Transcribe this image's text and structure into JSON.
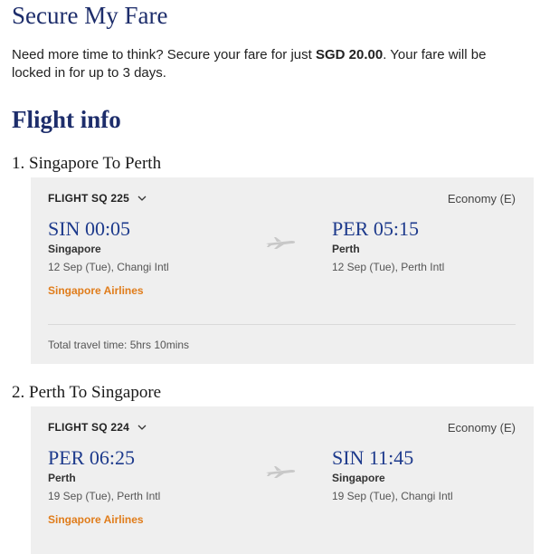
{
  "header": {
    "title": "Secure My Fare",
    "intro_before": "Need more time to think? Secure your fare for just ",
    "intro_price": "SGD 20.00",
    "intro_after": ". Your fare will be locked in for up to 3 days."
  },
  "flight_info": {
    "title": "Flight info",
    "routes": [
      {
        "heading": "1. Singapore To Perth",
        "flight_label": "FLIGHT SQ 225",
        "cabin": "Economy (E)",
        "departure": {
          "code_time": "SIN 00:05",
          "city": "Singapore",
          "detail": "12 Sep (Tue), Changi Intl"
        },
        "arrival": {
          "code_time": "PER 05:15",
          "city": "Perth",
          "detail": "12 Sep (Tue), Perth Intl"
        },
        "airline": "Singapore Airlines",
        "total_time": "Total travel time: 5hrs 10mins"
      },
      {
        "heading": "2. Perth To Singapore",
        "flight_label": "FLIGHT SQ 224",
        "cabin": "Economy (E)",
        "departure": {
          "code_time": "PER 06:25",
          "city": "Perth",
          "detail": "19 Sep (Tue), Perth Intl"
        },
        "arrival": {
          "code_time": "SIN 11:45",
          "city": "Singapore",
          "detail": "19 Sep (Tue), Changi Intl"
        },
        "airline": "Singapore Airlines"
      }
    ]
  },
  "icons": {
    "expand": "chevron-down-icon",
    "flight": "airplane-icon"
  },
  "colors": {
    "heading": "#1d2d6b",
    "code_time": "#1d3a8c",
    "airline": "#e07c1a",
    "card_bg": "#efefef"
  }
}
